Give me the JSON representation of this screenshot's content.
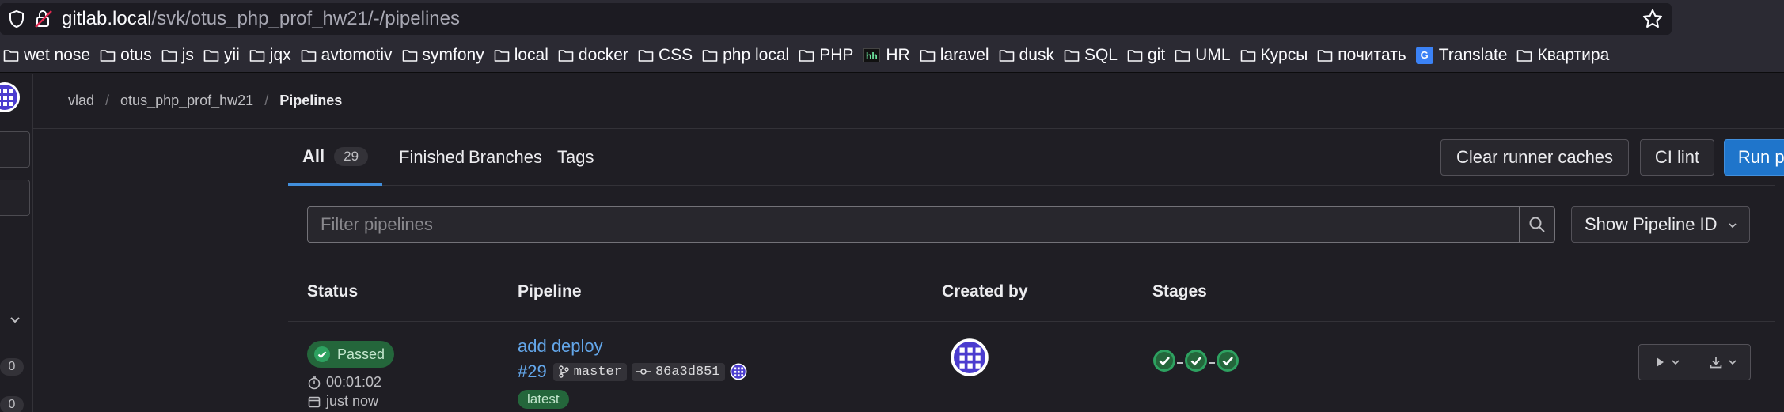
{
  "browser": {
    "url_host": "gitlab.local",
    "url_path": "/svk/otus_php_prof_hw21/-/pipelines",
    "bookmarks": [
      {
        "label": "wet nose",
        "icon": "folder-icon"
      },
      {
        "label": "otus",
        "icon": "folder-icon"
      },
      {
        "label": "js",
        "icon": "folder-icon"
      },
      {
        "label": "yii",
        "icon": "folder-icon"
      },
      {
        "label": "jqx",
        "icon": "folder-icon"
      },
      {
        "label": "avtomotiv",
        "icon": "folder-icon"
      },
      {
        "label": "symfony",
        "icon": "folder-icon"
      },
      {
        "label": "local",
        "icon": "folder-icon"
      },
      {
        "label": "docker",
        "icon": "folder-icon"
      },
      {
        "label": "CSS",
        "icon": "folder-icon"
      },
      {
        "label": "php local",
        "icon": "folder-icon"
      },
      {
        "label": "PHP",
        "icon": "folder-icon"
      },
      {
        "label": "HR",
        "icon": "hh-icon"
      },
      {
        "label": "laravel",
        "icon": "folder-icon"
      },
      {
        "label": "dusk",
        "icon": "folder-icon"
      },
      {
        "label": "SQL",
        "icon": "folder-icon"
      },
      {
        "label": "git",
        "icon": "folder-icon"
      },
      {
        "label": "UML",
        "icon": "folder-icon"
      },
      {
        "label": "Курсы",
        "icon": "folder-icon"
      },
      {
        "label": "почитать",
        "icon": "folder-icon"
      },
      {
        "label": "Translate",
        "icon": "translate-icon"
      },
      {
        "label": "Квартира",
        "icon": "folder-icon"
      }
    ]
  },
  "sidebar": {
    "counts": [
      "0",
      "0"
    ]
  },
  "breadcrumb": {
    "user": "vlad",
    "project": "otus_php_prof_hw21",
    "current": "Pipelines"
  },
  "tabs": {
    "all": "All",
    "all_count": "29",
    "finished": "Finished",
    "branches": "Branches",
    "tags": "Tags"
  },
  "actions": {
    "clear_caches": "Clear runner caches",
    "ci_lint": "CI lint",
    "run_pipeline": "Run pipeline"
  },
  "filter": {
    "placeholder": "Filter pipelines",
    "show_id": "Show Pipeline ID"
  },
  "table": {
    "headers": {
      "status": "Status",
      "pipeline": "Pipeline",
      "created_by": "Created by",
      "stages": "Stages"
    },
    "rows": [
      {
        "status": "Passed",
        "duration": "00:01:02",
        "finished": "just now",
        "title": "add deploy",
        "id": "#29",
        "branch": "master",
        "commit": "86a3d851",
        "label": "latest",
        "stages": [
          "passed",
          "passed",
          "passed"
        ]
      }
    ]
  },
  "colors": {
    "accent": "#1f75cb",
    "link": "#63a6e9",
    "success": "#2da160"
  }
}
